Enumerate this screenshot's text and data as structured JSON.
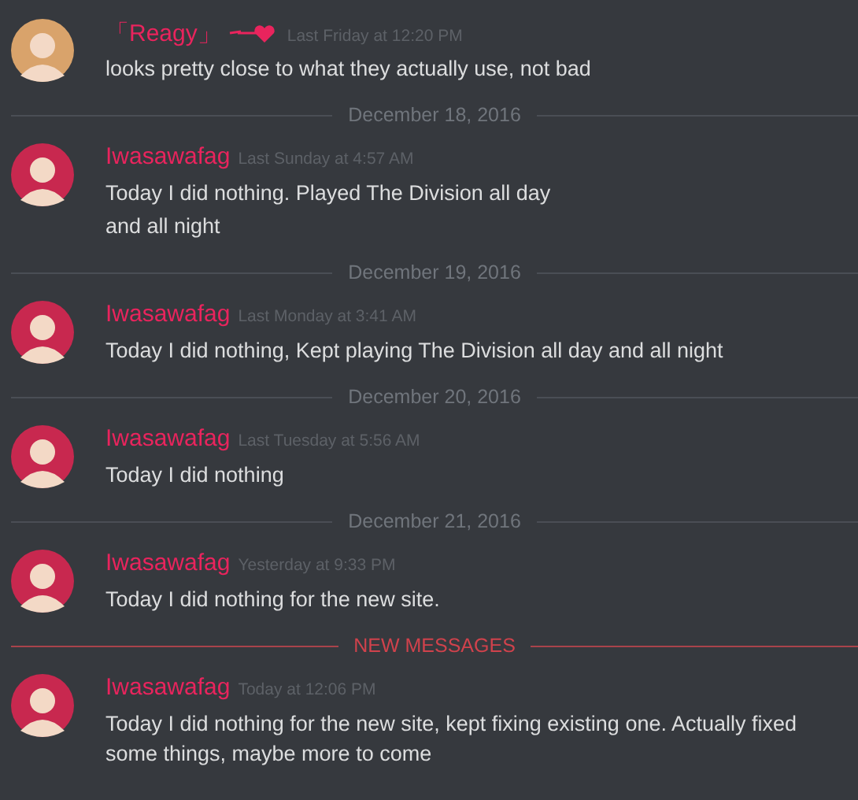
{
  "feed": [
    {
      "kind": "message",
      "author": "「Reagy」",
      "badge": true,
      "color": "#d9a36b",
      "time": "Last Friday at 12:20 PM",
      "lines": [
        "looks pretty close to what they actually use, not bad"
      ]
    },
    {
      "kind": "date",
      "label": "December 18, 2016"
    },
    {
      "kind": "message",
      "author": "Iwasawafag",
      "badge": false,
      "color": "#c8284f",
      "time": "Last Sunday at 4:57 AM",
      "lines": [
        "Today I did nothing. Played The Division all day",
        "and all night"
      ]
    },
    {
      "kind": "date",
      "label": "December 19, 2016"
    },
    {
      "kind": "message",
      "author": "Iwasawafag",
      "badge": false,
      "color": "#c8284f",
      "time": "Last Monday at 3:41 AM",
      "lines": [
        "Today I did nothing, Kept playing The Division all day and all night"
      ]
    },
    {
      "kind": "date",
      "label": "December 20, 2016"
    },
    {
      "kind": "message",
      "author": "Iwasawafag",
      "badge": false,
      "color": "#c8284f",
      "time": "Last Tuesday at 5:56 AM",
      "lines": [
        "Today I did nothing"
      ]
    },
    {
      "kind": "date",
      "label": "December 21, 2016"
    },
    {
      "kind": "message",
      "author": "Iwasawafag",
      "badge": false,
      "color": "#c8284f",
      "time": "Yesterday at 9:33 PM",
      "lines": [
        "Today I did nothing for the new site."
      ]
    },
    {
      "kind": "new",
      "label": "NEW MESSAGES"
    },
    {
      "kind": "message",
      "author": "Iwasawafag",
      "badge": false,
      "color": "#c8284f",
      "time": "Today at 12:06 PM",
      "lines": [
        "Today I did nothing for the new site, kept fixing existing one. Actually fixed some things, maybe more to come"
      ]
    }
  ]
}
